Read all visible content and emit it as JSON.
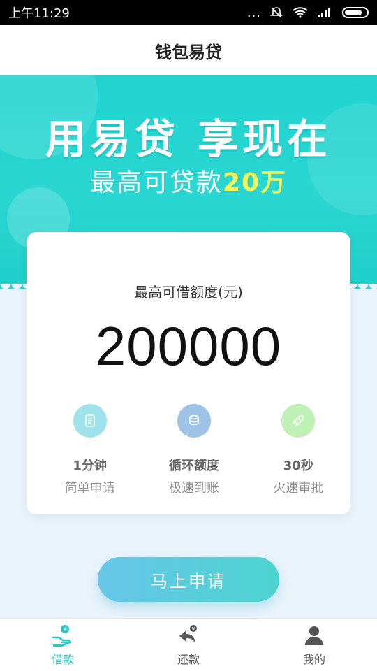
{
  "status_bar": {
    "time": "上午11:29",
    "signal_dots": "...",
    "icons": [
      "mute-icon",
      "wifi-icon",
      "signal-icon",
      "battery-icon"
    ]
  },
  "header": {
    "title": "钱包易贷"
  },
  "banner": {
    "headline": "用易贷 享现在",
    "subline_prefix": "最高可贷款",
    "subline_highlight": "20万"
  },
  "card": {
    "label": "最高可借额度(元)",
    "amount": "200000",
    "features": [
      {
        "icon": "document-icon",
        "title": "1分钟",
        "subtitle": "简单申请"
      },
      {
        "icon": "coins-icon",
        "title": "循环额度",
        "subtitle": "极速到账"
      },
      {
        "icon": "rocket-icon",
        "title": "30秒",
        "subtitle": "火速审批"
      }
    ]
  },
  "apply_button": {
    "label": "马上申请"
  },
  "tabs": [
    {
      "label": "借款",
      "icon": "borrow-icon",
      "active": true
    },
    {
      "label": "还款",
      "icon": "repay-icon",
      "active": false
    },
    {
      "label": "我的",
      "icon": "profile-icon",
      "active": false
    }
  ],
  "colors": {
    "accent": "#2fc7c3",
    "banner": "#22d4d0",
    "highlight": "#f2f55a"
  }
}
